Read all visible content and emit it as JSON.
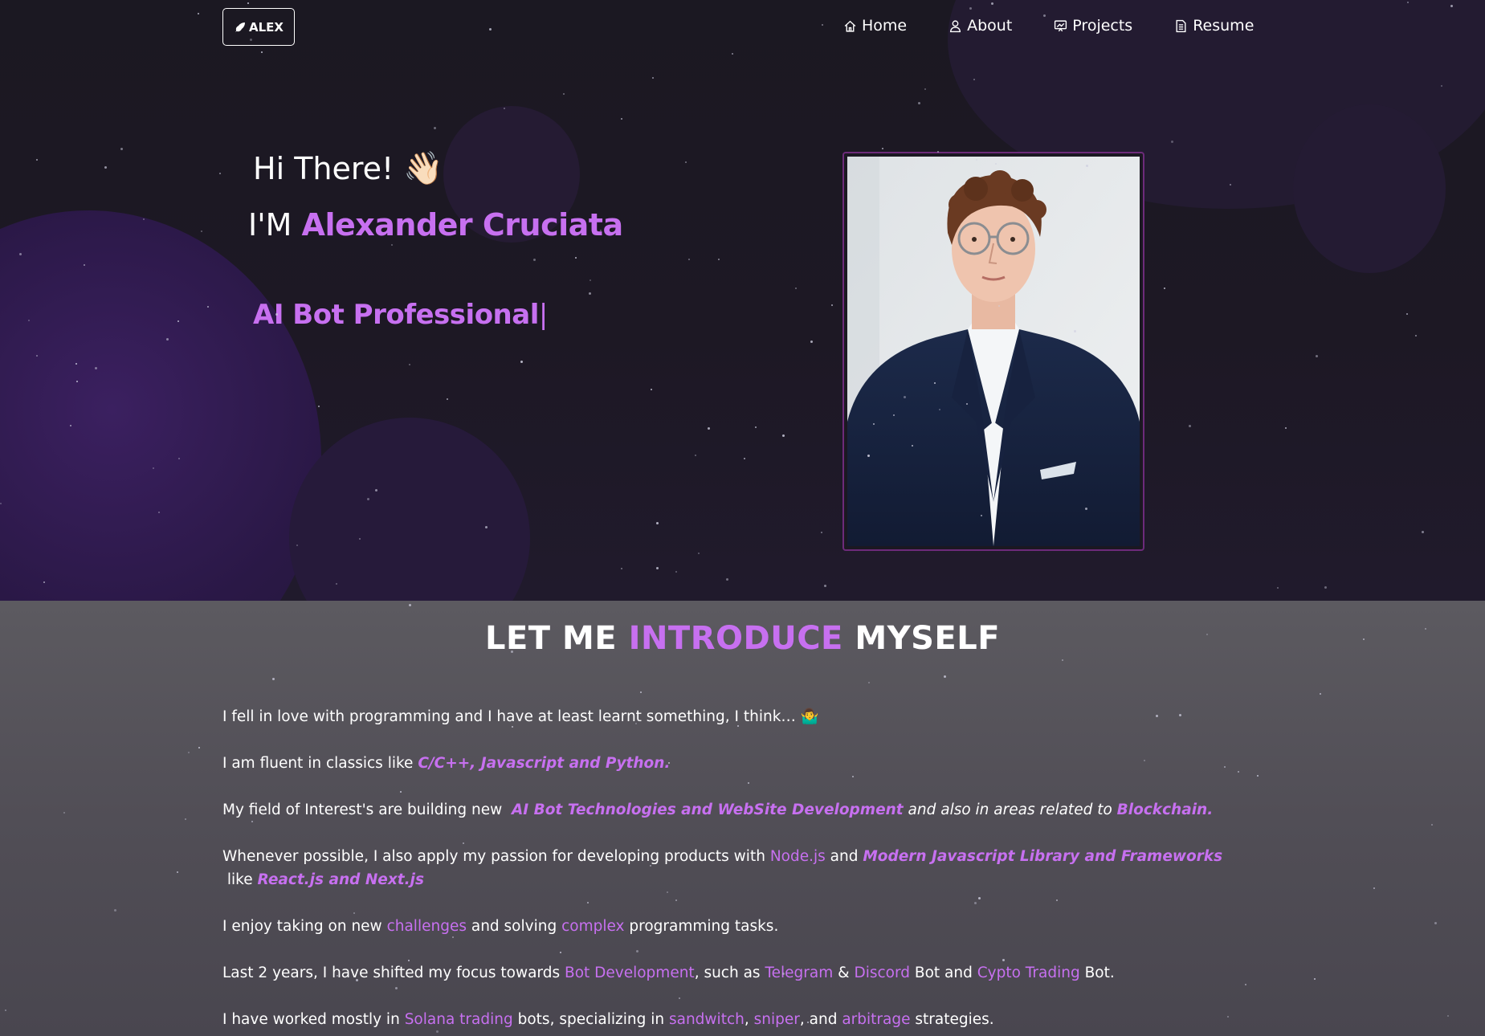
{
  "nav": {
    "logo_text": "ALEX",
    "items": [
      {
        "label": "Home",
        "icon": "home-icon"
      },
      {
        "label": "About",
        "icon": "user-icon"
      },
      {
        "label": "Projects",
        "icon": "projects-icon"
      },
      {
        "label": "Resume",
        "icon": "document-icon"
      }
    ]
  },
  "hero": {
    "greeting": "Hi There!",
    "wave_emoji": "👋🏻",
    "im_prefix": "I'M",
    "name": "Alexander Cruciata",
    "role": "AI Bot Professional",
    "cursor": "|"
  },
  "about": {
    "title_part1": "LET ME",
    "title_accent": "INTRODUCE",
    "title_part2": "MYSELF",
    "p1_text": "I fell in love with programming and I have at least learnt something, I think…",
    "p1_emoji": "🤷‍♂️",
    "p2_text": "I am fluent in classics like",
    "p2_hl": "C/C++, Javascript and Python.",
    "p3_text": "My field of Interest's are building new",
    "p3_hl1": "AI Bot Technologies and WebSite Development",
    "p3_mid": "and also in areas related to",
    "p3_hl2": "Blockchain.",
    "p4_text": "Whenever possible, I also apply my passion for developing products with",
    "p4_hl1": "Node.js",
    "p4_and": "and",
    "p4_hl2": "Modern Javascript Library and Frameworks",
    "p4_like": "like",
    "p4_hl3": "React.js and Next.js",
    "p5_a": "I enjoy taking on new",
    "p5_hl1": "challenges",
    "p5_b": "and solving",
    "p5_hl2": "complex",
    "p5_c": "programming tasks.",
    "p6_a": "Last 2 years, I have shifted my focus towards",
    "p6_hl1": "Bot Development",
    "p6_b": ", such as",
    "p6_hl2": "Telegram",
    "p6_amp": "&",
    "p6_hl3": "Discord",
    "p6_c": "Bot and",
    "p6_hl4": "Cypto Trading",
    "p6_d": "Bot.",
    "p7_a": "I have worked mostly in",
    "p7_hl1": "Solana trading",
    "p7_b": "bots, specializing in",
    "p7_hl2": "sandwitch",
    "p7_comma": ",",
    "p7_hl3": "sniper",
    "p7_c": ", and",
    "p7_hl4": "arbitrage",
    "p7_d": "strategies."
  },
  "colors": {
    "accent": "#c770f0",
    "hero_bg": "#1b1822",
    "about_bg": "#545158",
    "frame_border": "#6d2b7a"
  }
}
